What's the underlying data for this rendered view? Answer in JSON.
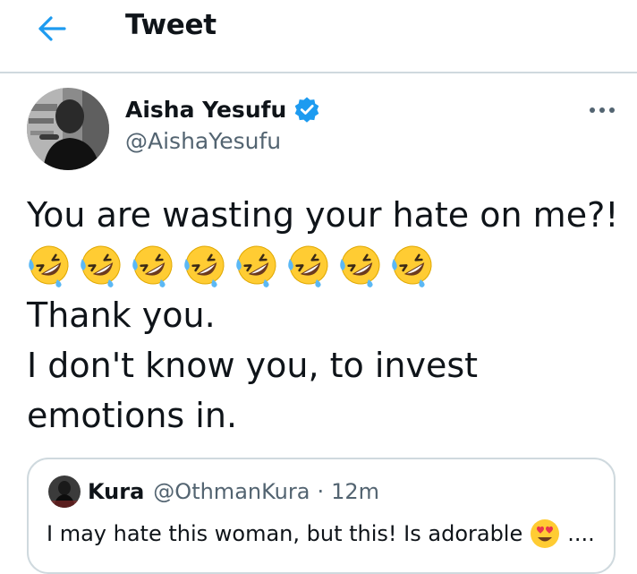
{
  "header": {
    "title": "Tweet",
    "back_icon": "arrow-left-icon",
    "accent_color": "#1d9bf0"
  },
  "tweet": {
    "author": {
      "name": "Aisha Yesufu",
      "handle": "@AishaYesufu",
      "verified": true,
      "verified_icon": "verified-badge-icon"
    },
    "more_icon": "more-horizontal-icon",
    "text_lines": [
      "You are wasting your hate on me?!",
      "Thank you.",
      "I don't know you, to invest",
      "emotions in."
    ],
    "emoji_line": {
      "emoji": "🤣",
      "emoji_name": "rolling-on-the-floor-laughing",
      "count": 8
    },
    "quoted_tweet": {
      "author_name": "Kura",
      "handle": "@OthmanKura",
      "separator": "·",
      "time": "12m",
      "text": "I may hate this woman, but this! Is adorable",
      "trailing_emoji": "😍",
      "trailing_emoji_name": "smiling-face-with-heart-eyes",
      "trailing_text": "...."
    }
  }
}
